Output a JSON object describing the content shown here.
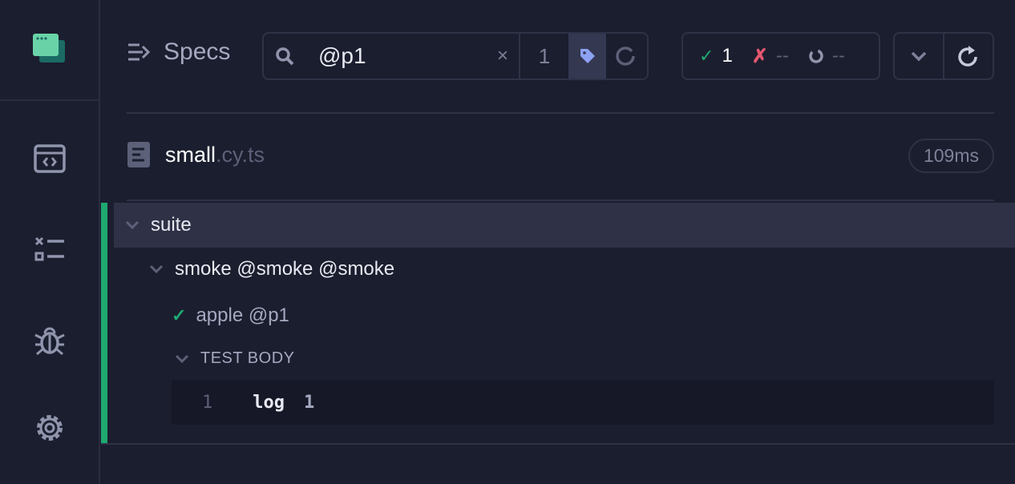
{
  "header": {
    "title": "Specs",
    "search_value": "@p1",
    "match_count": "1"
  },
  "stats": {
    "passed": "1",
    "failed": "--",
    "pending": "--"
  },
  "spec": {
    "name": "small",
    "ext": ".cy.ts",
    "duration": "109ms"
  },
  "tree": {
    "suite": "suite",
    "sub": "smoke @smoke @smoke",
    "test": "apple @p1",
    "section": "TEST BODY",
    "cmd_num": "1",
    "cmd_name": "log",
    "cmd_msg": "1"
  },
  "colors": {
    "pass": "#1fa971",
    "fail": "#e45770",
    "accent": "#8ea2f3"
  }
}
